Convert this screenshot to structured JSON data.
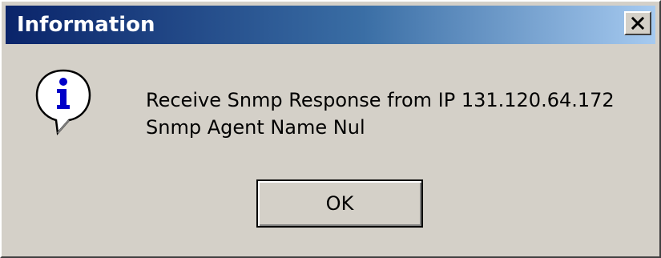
{
  "window": {
    "title": "Information",
    "close_icon": "close-icon"
  },
  "dialog": {
    "icon": "information-icon",
    "message_lines": [
      "Receive Snmp Response from IP 131.120.64.172",
      "Snmp Agent Name Nul"
    ],
    "ok_label": "OK"
  },
  "colors": {
    "titlebar_start": "#0a246a",
    "titlebar_end": "#a6caf0",
    "face": "#d4d0c8",
    "icon_blue": "#0000c8"
  }
}
